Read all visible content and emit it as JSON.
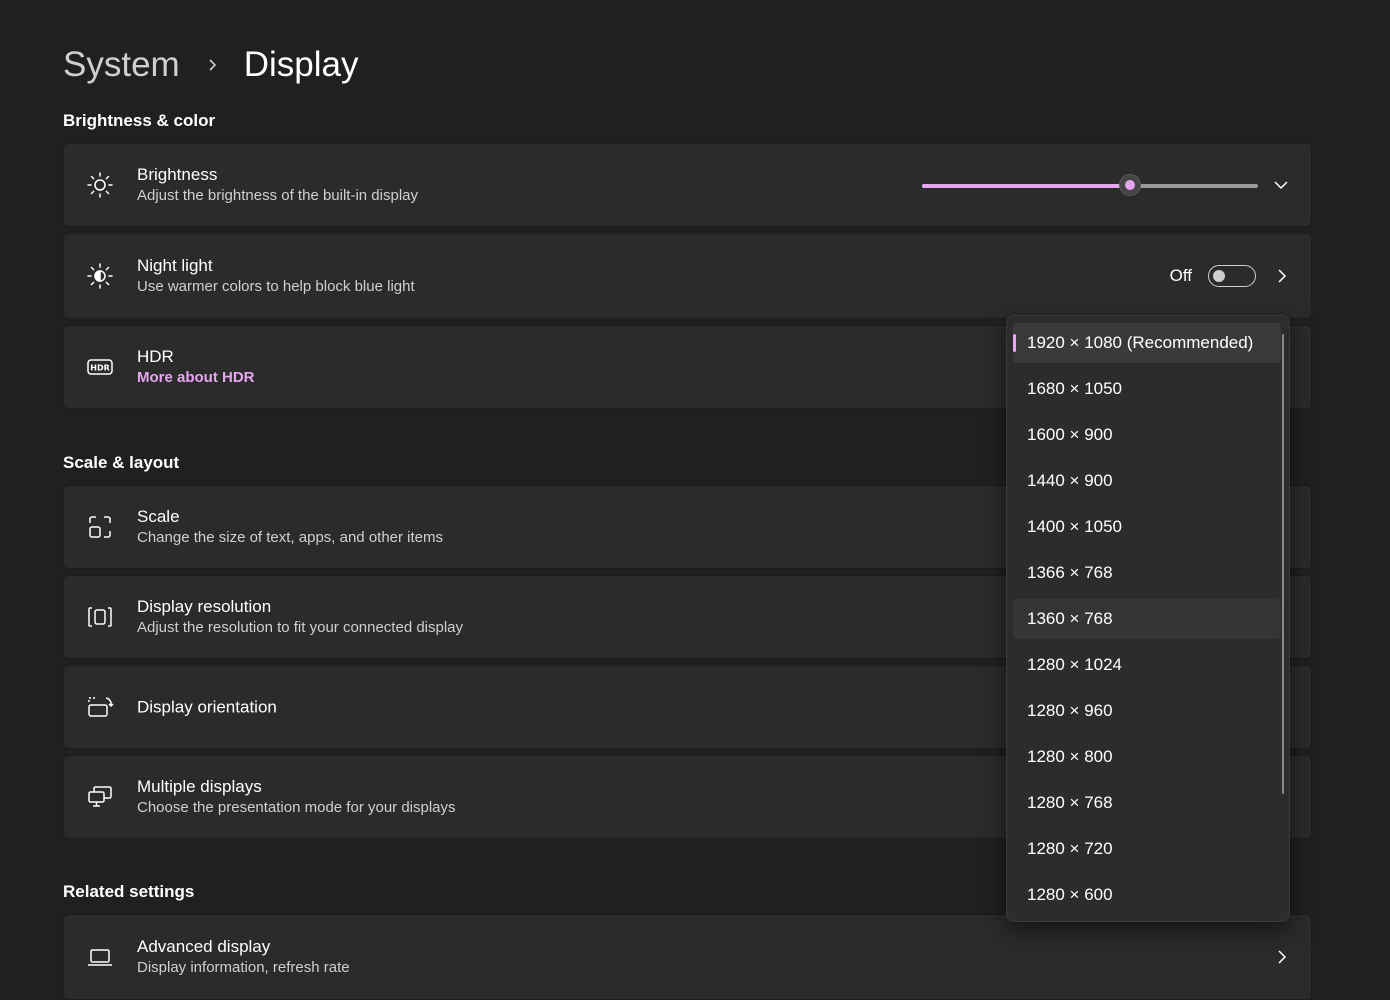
{
  "breadcrumb": {
    "parent": "System",
    "current": "Display"
  },
  "sections": {
    "brightness_color": "Brightness & color",
    "scale_layout": "Scale & layout",
    "related": "Related settings"
  },
  "brightness": {
    "title": "Brightness",
    "desc": "Adjust the brightness of the built-in display",
    "level_percent": 62
  },
  "night_light": {
    "title": "Night light",
    "desc": "Use warmer colors to help block blue light",
    "state": "Off"
  },
  "hdr": {
    "title": "HDR",
    "link": "More about HDR"
  },
  "scale": {
    "title": "Scale",
    "desc": "Change the size of text, apps, and other items"
  },
  "resolution": {
    "title": "Display resolution",
    "desc": "Adjust the resolution to fit your connected display"
  },
  "orientation": {
    "title": "Display orientation"
  },
  "multiple": {
    "title": "Multiple displays",
    "desc": "Choose the presentation mode for your displays"
  },
  "advanced": {
    "title": "Advanced display",
    "desc": "Display information, refresh rate"
  },
  "resolution_options": [
    "1920 × 1080 (Recommended)",
    "1680 × 1050",
    "1600 × 900",
    "1440 × 900",
    "1400 × 1050",
    "1366 × 768",
    "1360 × 768",
    "1280 × 1024",
    "1280 × 960",
    "1280 × 800",
    "1280 × 768",
    "1280 × 720",
    "1280 × 600"
  ],
  "selected_resolution_index": 0,
  "hovered_resolution_index": 6,
  "colors": {
    "accent": "#e6a6f0",
    "background": "#202020",
    "card": "#2b2b2b"
  },
  "icons": [
    "chevron-right-icon",
    "sun-icon",
    "chevron-down-icon",
    "night-light-icon",
    "hdr-icon",
    "scale-icon",
    "resolution-icon",
    "orientation-icon",
    "multiple-displays-icon",
    "laptop-icon"
  ]
}
